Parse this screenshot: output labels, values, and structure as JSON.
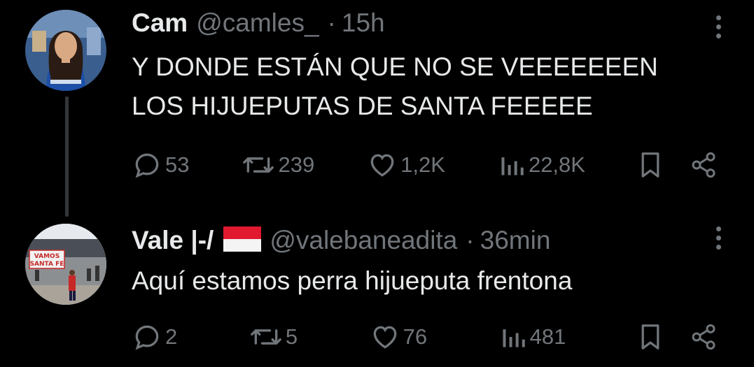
{
  "tweets": [
    {
      "name": "Cam",
      "handle": "@camles_",
      "separator": "·",
      "time": "15h",
      "text": "Y DONDE ESTÁN QUE NO SE VEEEEEEEN\nLOS HIJUEPUTAS DE SANTA FEEEEE",
      "replies": "53",
      "retweets": "239",
      "likes": "1,2K",
      "views": "22,8K"
    },
    {
      "name": "Vale |-/",
      "flag": "indonesia-flag-emoji",
      "handle": "@valebaneadita",
      "separator": "·",
      "time": "36min",
      "text": "Aquí estamos perra hijueputa frentona",
      "avatar_sign": "VAMOS SANTA FE",
      "replies": "2",
      "retweets": "5",
      "likes": "76",
      "views": "481"
    }
  ],
  "colors": {
    "background": "#000000",
    "text": "#e7e9ea",
    "muted": "#71767b",
    "thread_line": "#333639"
  }
}
